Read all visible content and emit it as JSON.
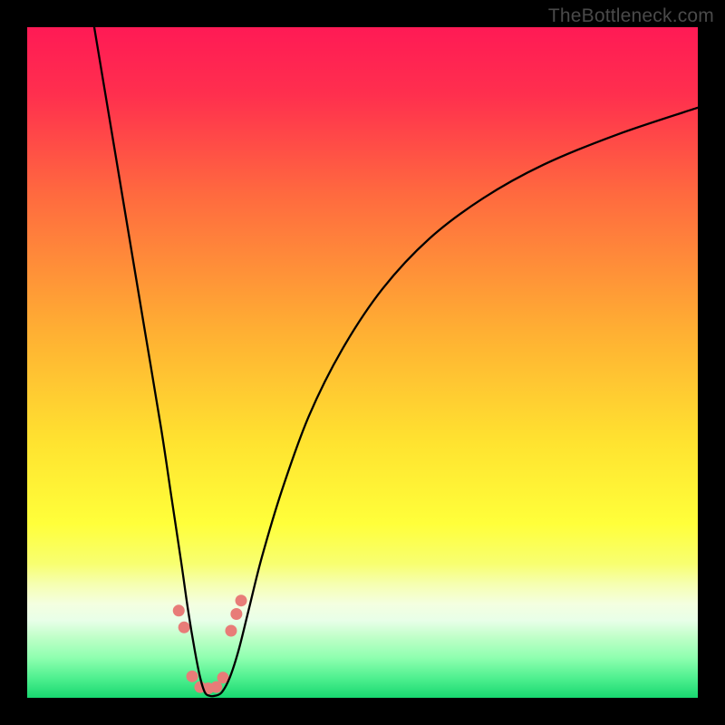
{
  "watermark": "TheBottleneck.com",
  "chart_data": {
    "type": "line",
    "title": "",
    "xlabel": "",
    "ylabel": "",
    "xlim": [
      0,
      100
    ],
    "ylim": [
      0,
      100
    ],
    "grid": false,
    "legend": false,
    "background_gradient_stops": [
      {
        "offset": 0.0,
        "color": "#ff1a55"
      },
      {
        "offset": 0.1,
        "color": "#ff2f4e"
      },
      {
        "offset": 0.25,
        "color": "#ff6a3f"
      },
      {
        "offset": 0.45,
        "color": "#ffae33"
      },
      {
        "offset": 0.62,
        "color": "#ffe330"
      },
      {
        "offset": 0.74,
        "color": "#ffff3a"
      },
      {
        "offset": 0.8,
        "color": "#f8ff70"
      },
      {
        "offset": 0.83,
        "color": "#f6ffb0"
      },
      {
        "offset": 0.86,
        "color": "#f4ffe0"
      },
      {
        "offset": 0.885,
        "color": "#e8ffe8"
      },
      {
        "offset": 0.91,
        "color": "#bfffc8"
      },
      {
        "offset": 0.94,
        "color": "#8fffb0"
      },
      {
        "offset": 0.97,
        "color": "#50f090"
      },
      {
        "offset": 1.0,
        "color": "#18d870"
      }
    ],
    "series": [
      {
        "name": "bottleneck-curve",
        "color": "#000000",
        "stroke_width": 2.3,
        "x": [
          10.0,
          12.5,
          15.0,
          17.5,
          20.0,
          21.5,
          23.0,
          24.0,
          25.0,
          25.8,
          26.5,
          27.2,
          28.0,
          29.0,
          30.2,
          31.5,
          33.0,
          35.0,
          38.0,
          42.0,
          47.0,
          53.0,
          60.0,
          68.0,
          77.0,
          88.0,
          100.0
        ],
        "y": [
          100.0,
          85.0,
          70.0,
          55.0,
          40.0,
          30.0,
          20.0,
          13.0,
          7.0,
          3.0,
          0.8,
          0.3,
          0.3,
          0.8,
          3.0,
          7.0,
          13.0,
          21.0,
          31.0,
          42.0,
          52.0,
          61.0,
          68.5,
          74.5,
          79.5,
          84.0,
          88.0
        ]
      }
    ],
    "markers": [
      {
        "name": "highlight-dots",
        "color": "#e87c78",
        "radius": 6.5,
        "x": [
          22.6,
          23.4,
          24.6,
          25.8,
          27.0,
          28.2,
          29.2,
          30.4,
          31.2,
          31.9
        ],
        "y": [
          13.0,
          10.5,
          3.2,
          1.6,
          1.4,
          1.6,
          3.0,
          10.0,
          12.5,
          14.5
        ]
      }
    ]
  }
}
